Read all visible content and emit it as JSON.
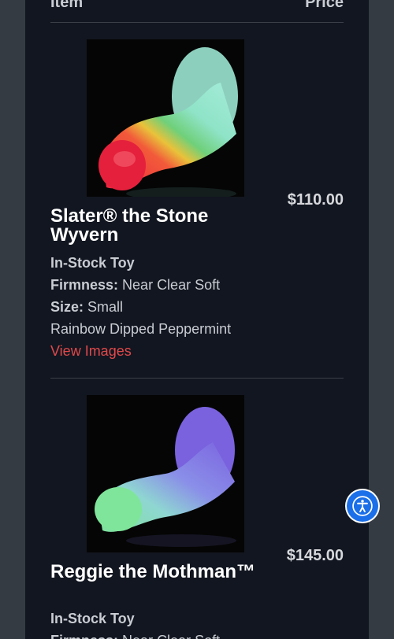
{
  "table": {
    "col_item": "Item",
    "col_price": "Price"
  },
  "items": [
    {
      "name": "Slater® the Stone Wyvern",
      "price": "$110.00",
      "stock": "In-Stock Toy",
      "firmness_label": "Firmness:",
      "firmness": "Near Clear Soft",
      "size_label": "Size:",
      "size": "Small",
      "color": "Rainbow Dipped Peppermint",
      "view_link": "View Images"
    },
    {
      "name": "Reggie the Mothman™",
      "price": "$145.00",
      "stock": "In-Stock Toy",
      "firmness_label": "Firmness:",
      "firmness": "Near Clear Soft"
    }
  ],
  "accessibility": {
    "icon": "accessibility-icon",
    "color": "#1b6fe8"
  }
}
